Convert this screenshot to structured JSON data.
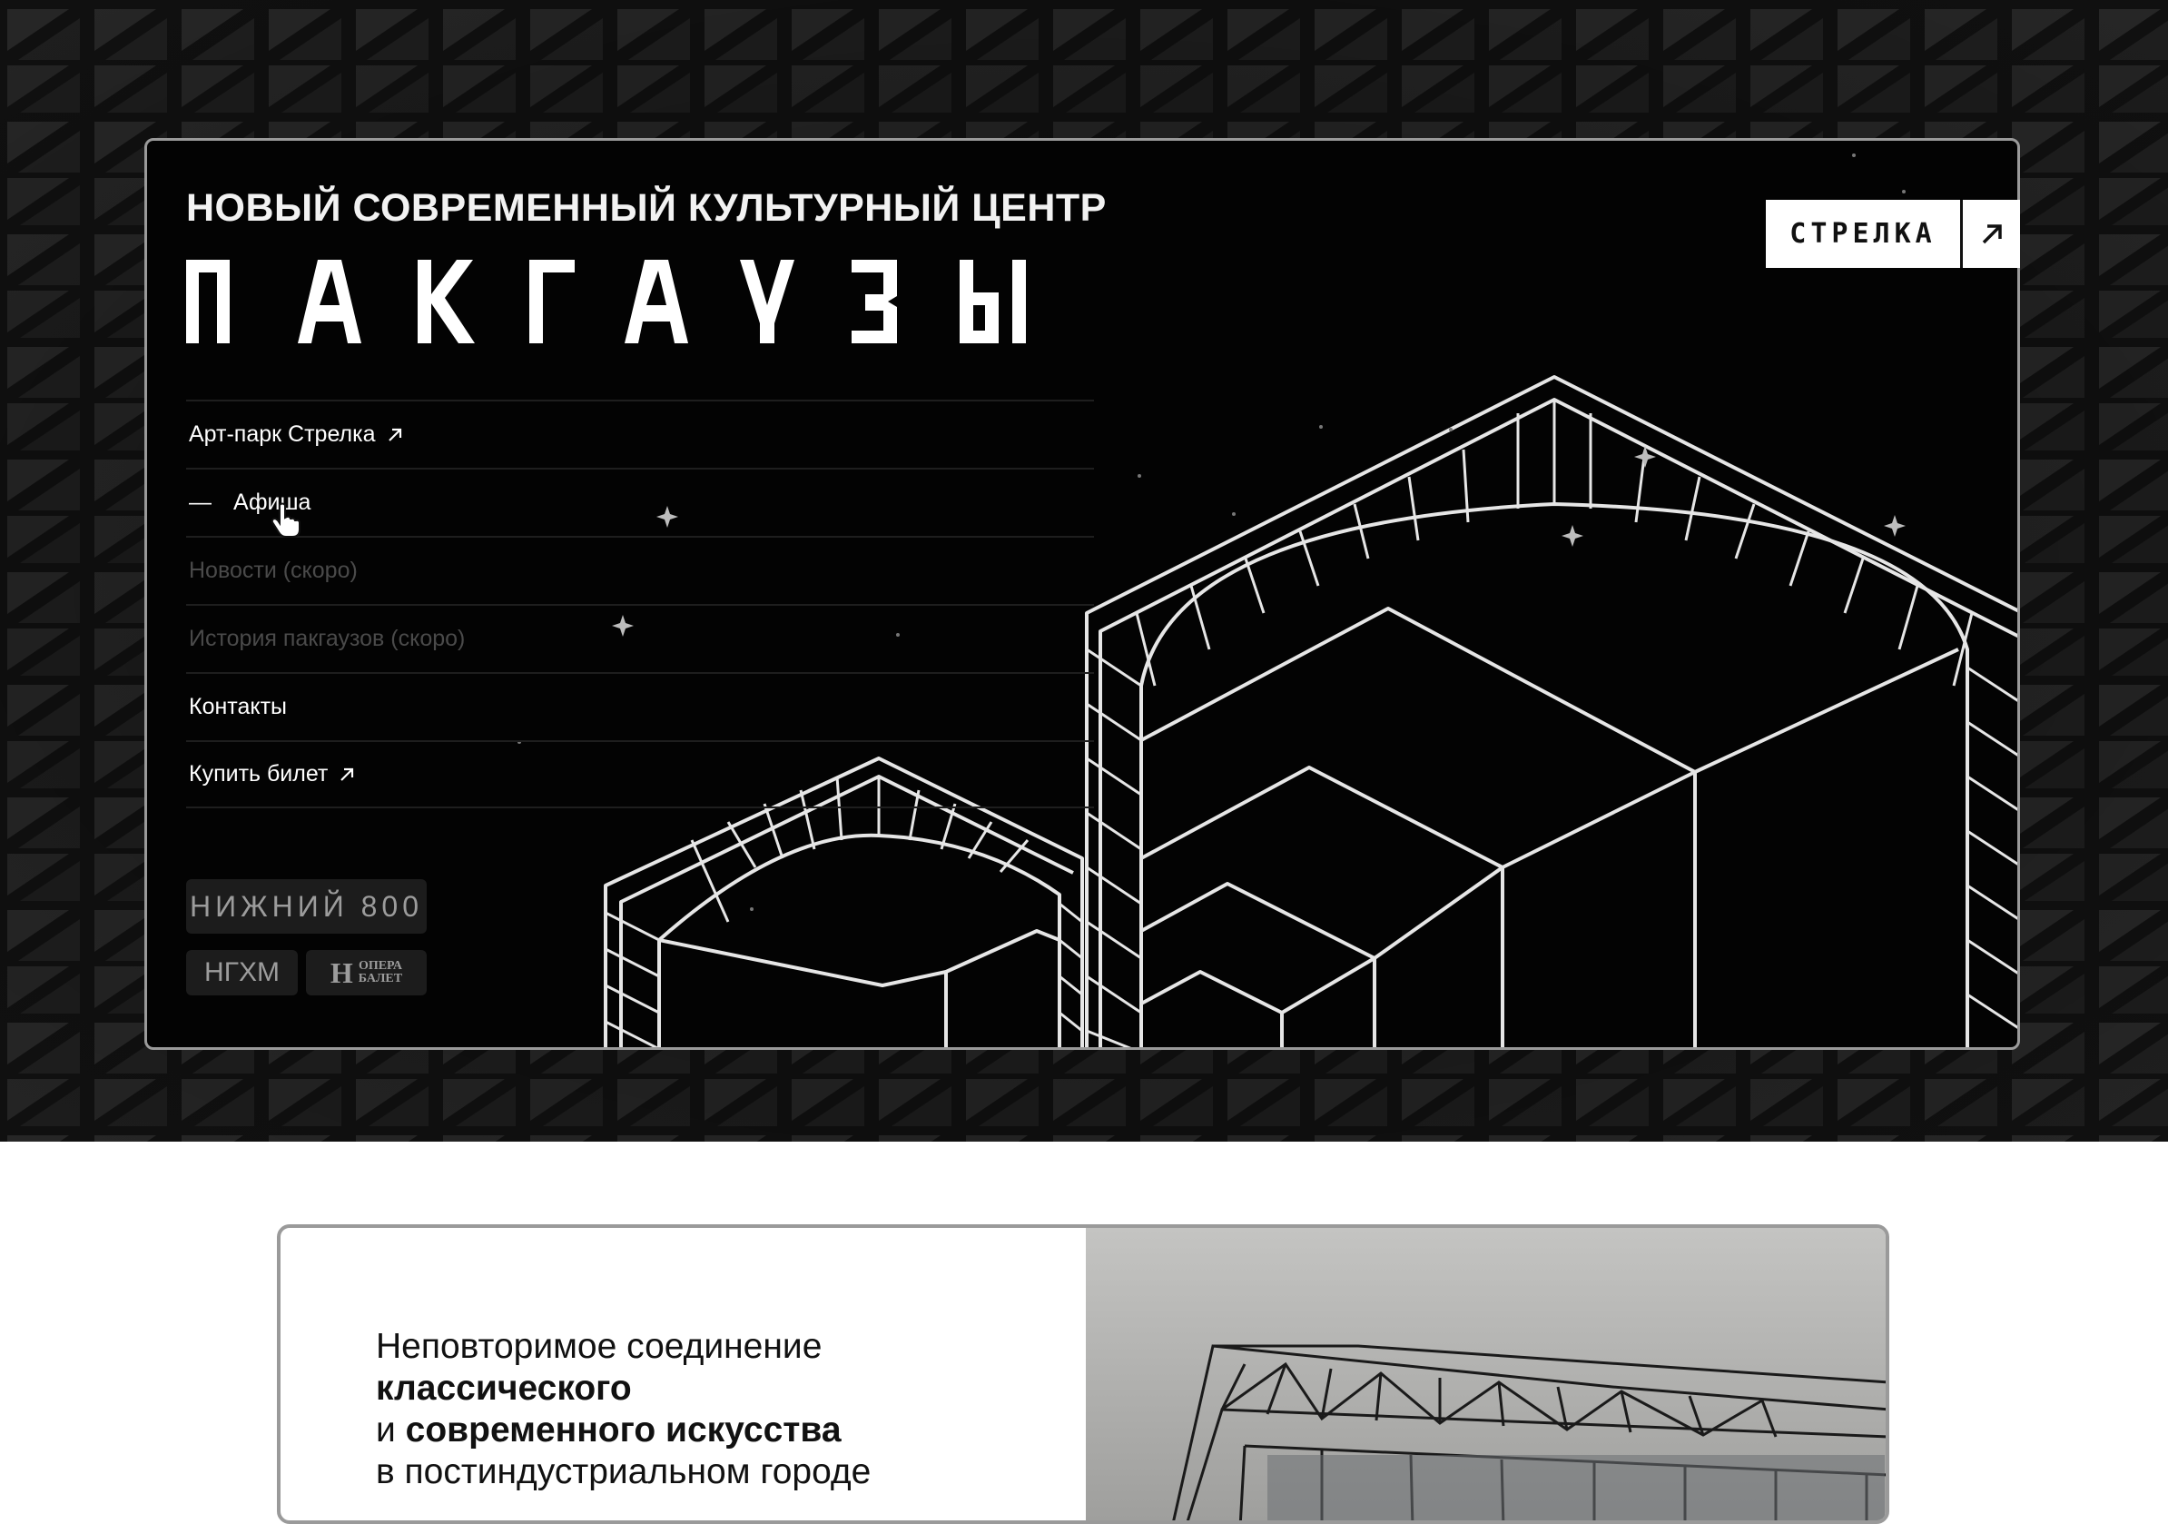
{
  "hero": {
    "subtitle": "НОВЫЙ СОВРЕМЕННЫЙ КУЛЬТУРНЫЙ ЦЕНТР",
    "title": "ПАКГАУЗЫ",
    "badge_label": "СТРЕЛКА"
  },
  "nav": {
    "items": [
      {
        "label": "Арт-парк Стрелка",
        "external": true
      },
      {
        "label": "Афиша",
        "active": true,
        "marker": "—"
      },
      {
        "label": "Новости  (скоро)"
      },
      {
        "label": "История пакгаузов (скоро)"
      },
      {
        "label": "Контакты"
      },
      {
        "label": "Купить билет",
        "external": true
      }
    ]
  },
  "partners": {
    "nizhny": "НИЖНИЙ 800",
    "ngxm": "НГХМ",
    "opera_line1": "ОПЕРА",
    "opera_line2": "БАЛЕТ",
    "opera_glyph": "Н"
  },
  "intro": {
    "line1": "Неповторимое соединение",
    "line2_bold": "классического",
    "line3_and": "и",
    "line3_bold": "современного искусства",
    "line4": "в постиндустриальном городе"
  },
  "colors": {
    "background": "#030303",
    "frame": "#9a9a9a",
    "text": "#ffffff",
    "dim": "#4a4a4a"
  }
}
